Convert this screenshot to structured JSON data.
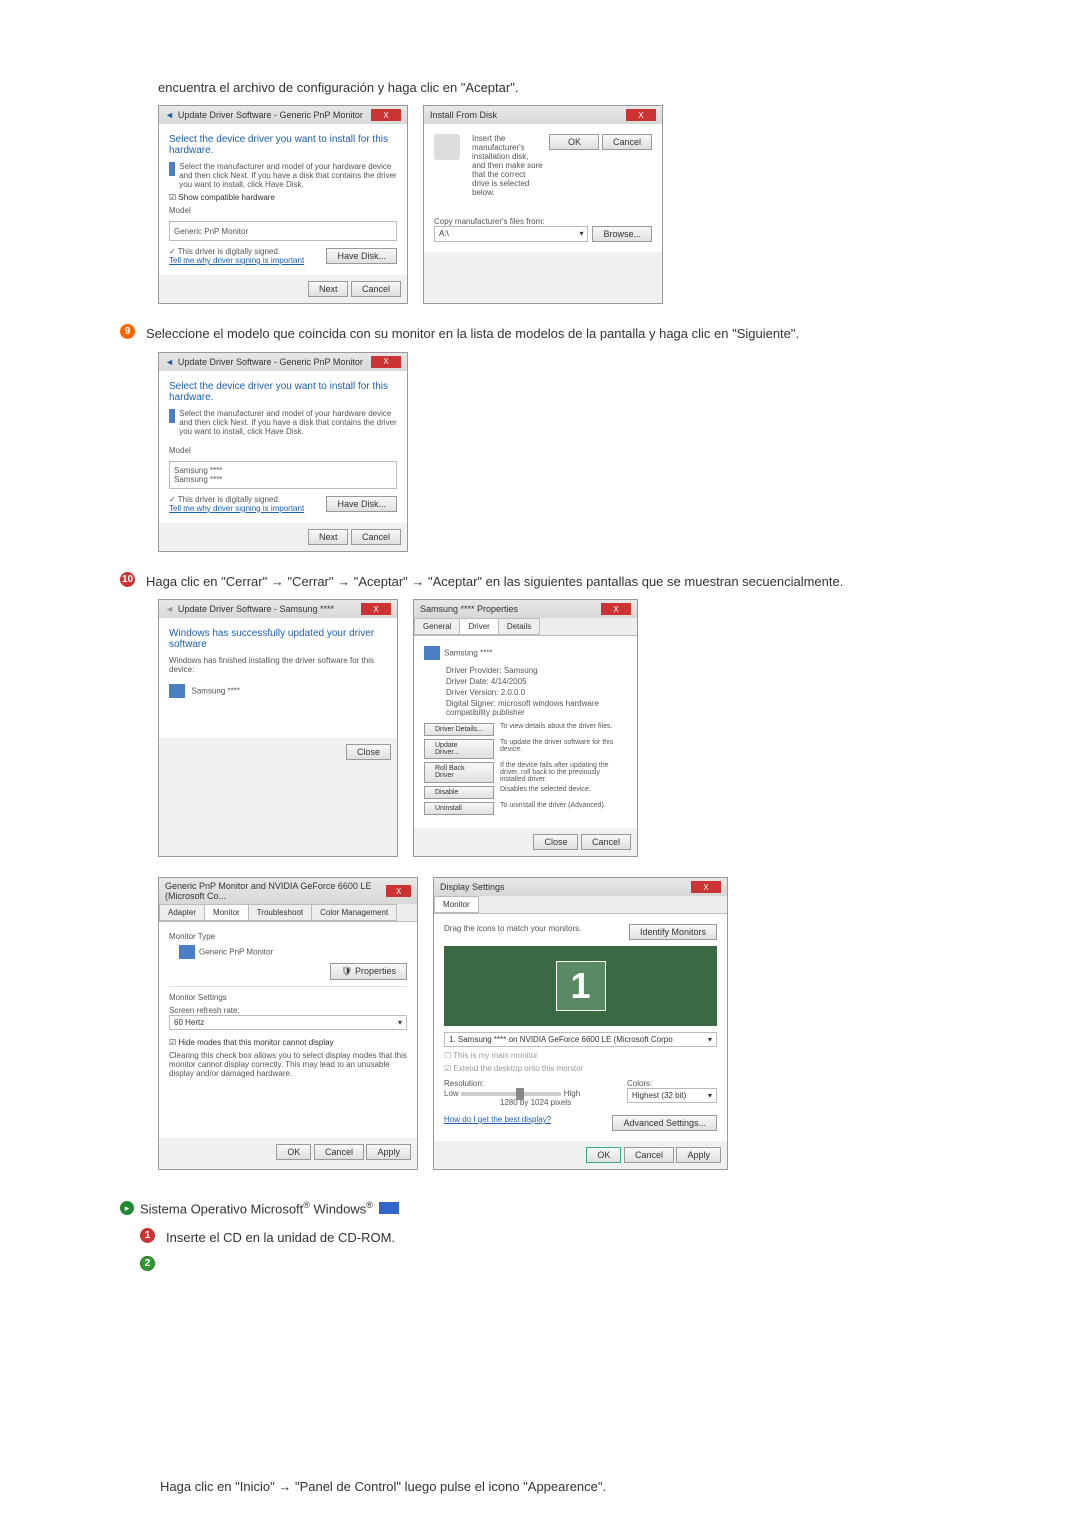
{
  "intro": "encuentra el archivo de configuración y haga clic en \"Aceptar\".",
  "step9": {
    "text": "Seleccione el modelo que coincida con su monitor en la lista de modelos de la pantalla y haga clic en \"Siguiente\"."
  },
  "step10": {
    "text": "Haga clic en \"Cerrar\" → \"Cerrar\" → \"Aceptar\" → \"Aceptar\" en las siguientes pantallas que se muestran secuencialmente."
  },
  "section2": {
    "title": "Sistema Operativo Microsoft",
    "regmark": "®",
    "os": " Windows",
    "regmark2": "®"
  },
  "step1": {
    "text": "Inserte el CD en la unidad de CD-ROM."
  },
  "footer": "Haga clic en \"Inicio\" →  \"Panel de Control\" luego pulse el icono \"Appearence\".",
  "win_update": {
    "title": "Update Driver Software - Generic PnP Monitor",
    "header": "Select the device driver you want to install for this hardware.",
    "desc": "Select the manufacturer and model of your hardware device and then click Next. If you have a disk that contains the driver you want to install, click Have Disk.",
    "show_compat": "Show compatible hardware",
    "model": "Model",
    "item": "Generic PnP Monitor",
    "signed": "This driver is digitally signed.",
    "tellme": "Tell me why driver signing is important",
    "havedisk": "Have Disk...",
    "next": "Next",
    "cancel": "Cancel"
  },
  "win_update2": {
    "item1": "Samsung ****",
    "item2": "Samsung ****"
  },
  "win_install": {
    "title": "Install From Disk",
    "text": "Insert the manufacturer's installation disk, and then make sure that the correct drive is selected below.",
    "ok": "OK",
    "cancel": "Cancel",
    "copy": "Copy manufacturer's files from:",
    "browse": "Browse..."
  },
  "win_success": {
    "title": "Update Driver Software - Samsung ****",
    "header": "Windows has successfully updated your driver software",
    "desc": "Windows has finished installing the driver software for this device:",
    "device": "Samsung ****",
    "close": "Close"
  },
  "win_props": {
    "title": "Samsung **** Properties",
    "tabs": {
      "general": "General",
      "driver": "Driver",
      "details": "Details"
    },
    "device": "Samsung ****",
    "provider_l": "Driver Provider:",
    "provider_v": "Samsung",
    "date_l": "Driver Date:",
    "date_v": "4/14/2005",
    "version_l": "Driver Version:",
    "version_v": "2.0.0.0",
    "signer_l": "Digital Signer:",
    "signer_v": "microsoft windows hardware compatibility publisher",
    "b_details": "Driver Details...",
    "b_details_d": "To view details about the driver files.",
    "b_update": "Update Driver...",
    "b_update_d": "To update the driver software for this device.",
    "b_rollback": "Roll Back Driver",
    "b_rollback_d": "If the device fails after updating the driver, roll back to the previously installed driver.",
    "b_disable": "Disable",
    "b_disable_d": "Disables the selected device.",
    "b_uninstall": "Uninstall",
    "b_uninstall_d": "To uninstall the driver (Advanced).",
    "close": "Close",
    "cancel": "Cancel"
  },
  "win_generic": {
    "title": "Generic PnP Monitor and NVIDIA GeForce 6600 LE (Microsoft Co...",
    "tabs": {
      "adapter": "Adapter",
      "monitor": "Monitor",
      "troubleshoot": "Troubleshoot",
      "color": "Color Management"
    },
    "type": "Monitor Type",
    "typename": "Generic PnP Monitor",
    "properties": "Properties",
    "settings": "Monitor Settings",
    "refresh": "Screen refresh rate:",
    "hz": "60 Hertz",
    "hide": "Hide modes that this monitor cannot display",
    "hide_desc": "Clearing this check box allows you to select display modes that this monitor cannot display correctly. This may lead to an unusable display and/or damaged hardware.",
    "ok": "OK",
    "cancel": "Cancel",
    "apply": "Apply"
  },
  "win_display": {
    "title": "Display Settings",
    "tab": "Monitor",
    "drag": "Drag the icons to match your monitors.",
    "identify": "Identify Monitors",
    "num": "1",
    "select": "1. Samsung **** on NVIDIA GeForce 6600 LE (Microsoft Corpo",
    "main": "This is my main monitor",
    "extend": "Extend the desktop onto this monitor",
    "resolution": "Resolution:",
    "low": "Low",
    "high": "High",
    "res_val": "1280 by 1024 pixels",
    "colors": "Colors:",
    "color_val": "Highest (32 bit)",
    "best": "How do I get the best display?",
    "advanced": "Advanced Settings...",
    "ok": "OK",
    "cancel": "Cancel",
    "apply": "Apply"
  }
}
